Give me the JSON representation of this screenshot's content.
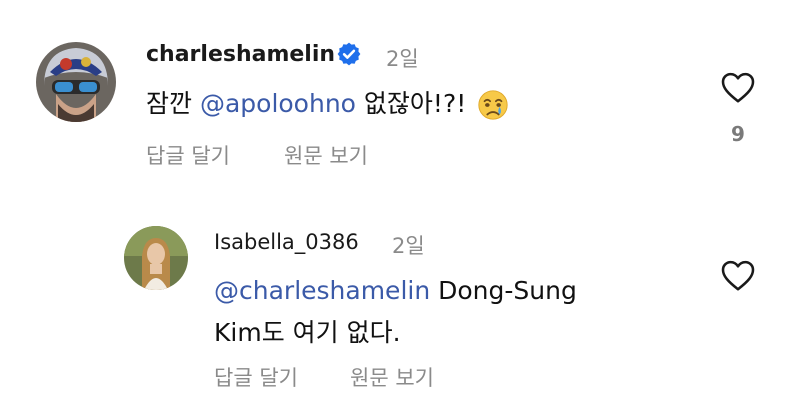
{
  "comments": [
    {
      "username": "charleshamelin",
      "verified": true,
      "time": "2일",
      "text_before": "잠깐 ",
      "mention": "@apoloohno",
      "text_after": " 없잖아!?!",
      "emoji": "crying-face-emoji",
      "reply_label": "답글 달기",
      "translate_label": "원문 보기",
      "likes": "9"
    },
    {
      "username": "Isabella_0386",
      "verified": false,
      "time": "2일",
      "mention": "@charleshamelin",
      "text_line1_after": " Dong-Sung",
      "text_line2": "Kim도 여기 없다.",
      "reply_label": "답글 달기",
      "translate_label": "원문 보기"
    }
  ],
  "colors": {
    "mention": "#3b5aa8",
    "verified": "#1f6feb",
    "secondary_text": "#8a8a8a"
  }
}
